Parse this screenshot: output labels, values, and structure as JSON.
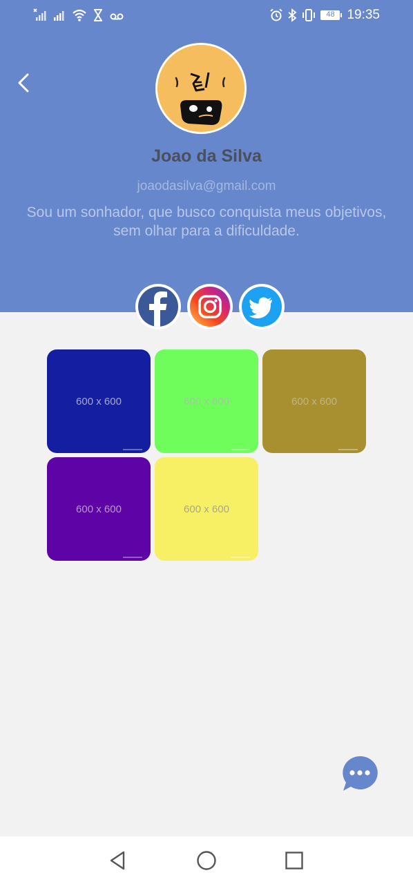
{
  "status_bar": {
    "time": "19:35",
    "battery": "48"
  },
  "profile": {
    "name": "Joao da Silva",
    "email": "joaodasilva@gmail.com",
    "bio_line1": "Sou um sonhador, que busco conquista meus objetivos,",
    "bio_line2": "sem olhar para a dificuldade."
  },
  "socials": [
    "facebook-icon",
    "instagram-icon",
    "twitter-icon"
  ],
  "gallery": {
    "tiles": [
      {
        "label": "600 x 600",
        "bg": "#131ea1",
        "fg": "#a6a9c9"
      },
      {
        "label": "600 x 600",
        "bg": "#6ffd5b",
        "fg": "#a5c6a0"
      },
      {
        "label": "600 x 600",
        "bg": "#a88f2f",
        "fg": "#c2b486"
      },
      {
        "label": "600 x 600",
        "bg": "#5e03a5",
        "fg": "#b89ac9"
      },
      {
        "label": "600 x 600",
        "bg": "#f8f064",
        "fg": "#a9a68c"
      }
    ]
  },
  "colors": {
    "header": "#6787cc",
    "background": "#f2f2f2",
    "accent": "#6787cc"
  }
}
